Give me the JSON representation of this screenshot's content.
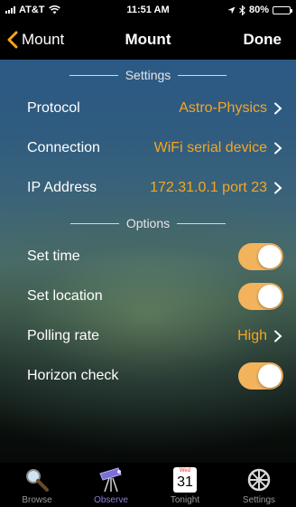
{
  "status": {
    "carrier": "AT&T",
    "time": "11:51 AM",
    "battery": "80%",
    "battery_level": 0.8
  },
  "nav": {
    "back_label": "Mount",
    "title": "Mount",
    "done_label": "Done"
  },
  "settings_section": {
    "header": "Settings",
    "rows": [
      {
        "label": "Protocol",
        "value": "Astro-Physics"
      },
      {
        "label": "Connection",
        "value": "WiFi serial device"
      },
      {
        "label": "IP Address",
        "value": "172.31.0.1 port 23"
      }
    ]
  },
  "options_section": {
    "header": "Options",
    "set_time": {
      "label": "Set time",
      "on": true
    },
    "set_location": {
      "label": "Set location",
      "on": true
    },
    "polling_rate": {
      "label": "Polling rate",
      "value": "High"
    },
    "horizon_check": {
      "label": "Horizon check",
      "on": true
    }
  },
  "tabs": {
    "browse": "Browse",
    "observe": "Observe",
    "tonight": "Tonight",
    "tonight_month": "Wed",
    "tonight_day": "31",
    "settings": "Settings"
  },
  "colors": {
    "accent": "#f5a623",
    "toggle_on": "#f2b35c",
    "active_tab": "#8a7dd9"
  }
}
